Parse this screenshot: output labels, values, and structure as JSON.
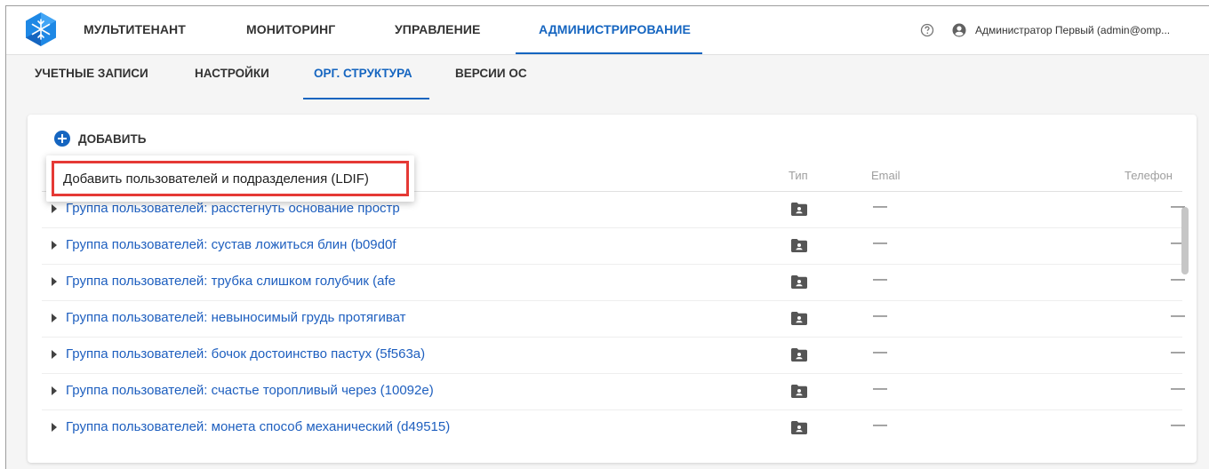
{
  "top_nav": {
    "items": [
      "МУЛЬТИТЕНАНТ",
      "МОНИТОРИНГ",
      "УПРАВЛЕНИЕ",
      "АДМИНИСТРИРОВАНИЕ"
    ],
    "active": "АДМИНИСТРИРОВАНИЕ",
    "user": "Администратор Первый (admin@omp..."
  },
  "sub_nav": {
    "items": [
      "УЧЕТНЫЕ ЗАПИСИ",
      "НАСТРОЙКИ",
      "ОРГ. СТРУКТУРА",
      "ВЕРСИИ ОС"
    ],
    "active": "ОРГ. СТРУКТУРА"
  },
  "toolbar": {
    "add_label": "ДОБАВИТЬ"
  },
  "menu": {
    "item_label": "Добавить пользователей и подразделения (LDIF)"
  },
  "table": {
    "headers": {
      "type": "Тип",
      "email": "Email",
      "phone": "Телефон"
    },
    "rows": [
      {
        "name": "Группа пользователей: расстегнуть основание простр",
        "email": "—",
        "phone": "—"
      },
      {
        "name": "Группа пользователей: сустав ложиться блин (b09d0f",
        "email": "—",
        "phone": "—"
      },
      {
        "name": "Группа пользователей: трубка слишком голубчик (afe",
        "email": "—",
        "phone": "—"
      },
      {
        "name": "Группа пользователей: невыносимый грудь протягиват",
        "email": "—",
        "phone": "—"
      },
      {
        "name": "Группа пользователей: бочок достоинство пастух (5f563a)",
        "email": "—",
        "phone": "—"
      },
      {
        "name": "Группа пользователей: счастье торопливый через (10092e)",
        "email": "—",
        "phone": "—"
      },
      {
        "name": "Группа пользователей: монета способ механический (d49515)",
        "email": "—",
        "phone": "—"
      }
    ]
  },
  "colors": {
    "accent": "#1565c0",
    "highlight_border": "#e53935"
  },
  "icons": {
    "logo": "snowflake-logo-icon",
    "help": "help-circle-icon",
    "user": "account-circle-icon",
    "add": "add-circle-icon",
    "type": "folder-account-icon",
    "expander": "caret-right-icon"
  }
}
